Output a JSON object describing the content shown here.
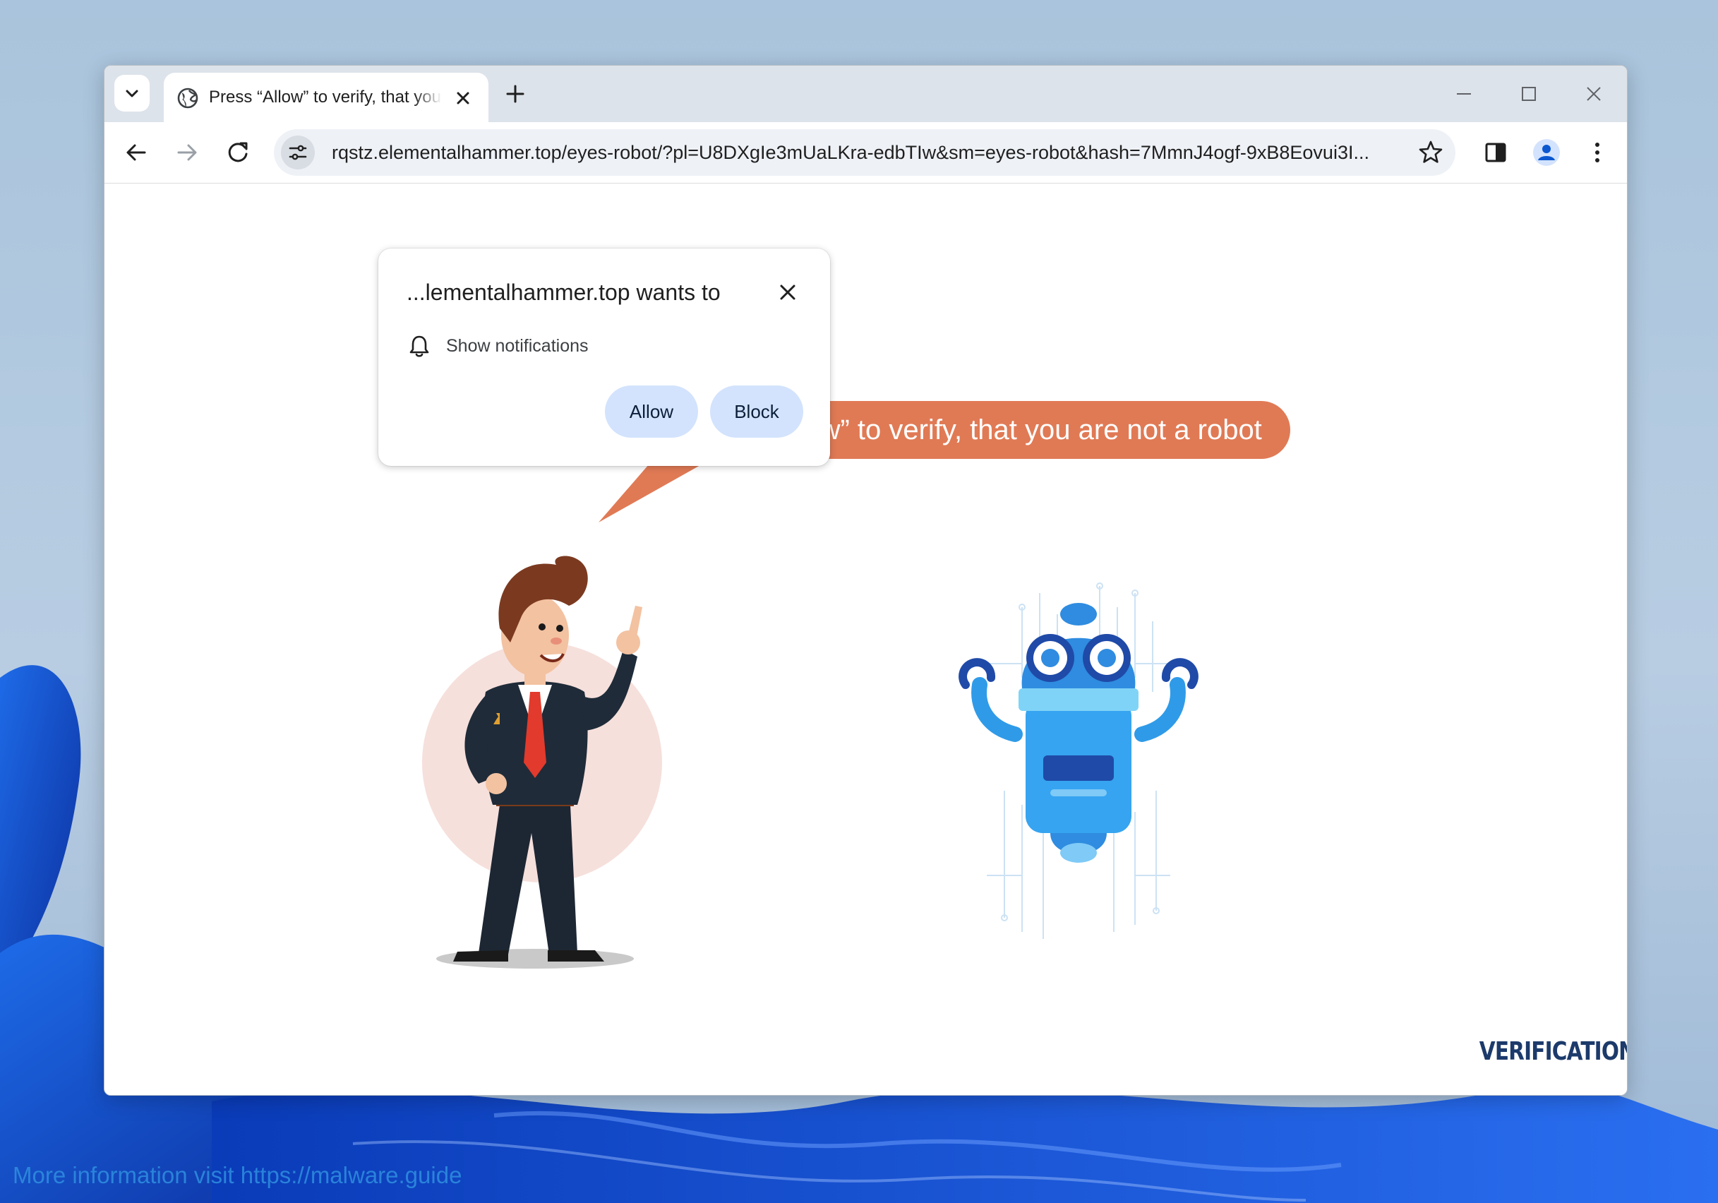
{
  "tab": {
    "title": "Press “Allow” to verify, that you are not a robot"
  },
  "omnibox": {
    "url": "rqstz.elementalhammer.top/eyes-robot/?pl=U8DXgIe3mUaLKra-edbTIw&sm=eyes-robot&hash=7MmnJ4ogf-9xB8Eovui3I..."
  },
  "permission_popup": {
    "title": "...lementalhammer.top wants to",
    "permission_label": "Show notifications",
    "allow_label": "Allow",
    "block_label": "Block"
  },
  "page": {
    "speech_bubble": "Press “Allow” to verify, that you are not a robot",
    "verification_logo": "VERIFICATION"
  },
  "footer": {
    "link_text": "More information visit https://malware.guide"
  },
  "colors": {
    "bubble": "#e07a55",
    "button_bg": "#d3e3fd",
    "robot_blue": "#2f9be8",
    "footer_link": "#2f8fe0"
  }
}
